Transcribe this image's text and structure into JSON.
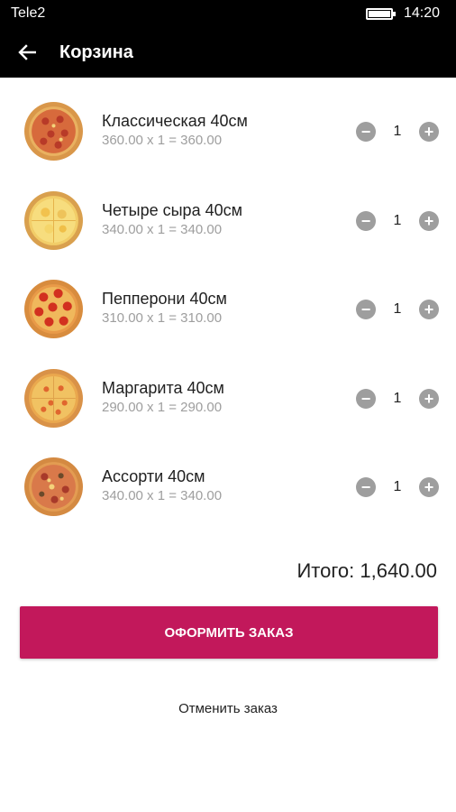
{
  "status_bar": {
    "carrier": "Tele2",
    "time": "14:20"
  },
  "app_bar": {
    "title": "Корзина",
    "back_icon": "arrow-left-icon"
  },
  "cart": {
    "items": [
      {
        "name": "Классическая 40см",
        "price_line": "360.00 x 1 = 360.00",
        "quantity": "1",
        "pizza": "classic"
      },
      {
        "name": "Четыре сыра 40см",
        "price_line": "340.00 x 1 = 340.00",
        "quantity": "1",
        "pizza": "four-cheese"
      },
      {
        "name": "Пепперони 40см",
        "price_line": "310.00 x 1 = 310.00",
        "quantity": "1",
        "pizza": "pepperoni"
      },
      {
        "name": "Маргарита 40см",
        "price_line": "290.00 x 1 = 290.00",
        "quantity": "1",
        "pizza": "margherita"
      },
      {
        "name": "Ассорти 40см",
        "price_line": "340.00 x 1 = 340.00",
        "quantity": "1",
        "pizza": "assorti"
      }
    ],
    "total": "Итого: 1,640.00"
  },
  "actions": {
    "checkout_label": "ОФОРМИТЬ ЗАКАЗ",
    "cancel_label": "Отменить заказ"
  },
  "colors": {
    "accent": "#c2185b",
    "app_bar": "#000000",
    "qty_button": "#9e9e9e"
  }
}
